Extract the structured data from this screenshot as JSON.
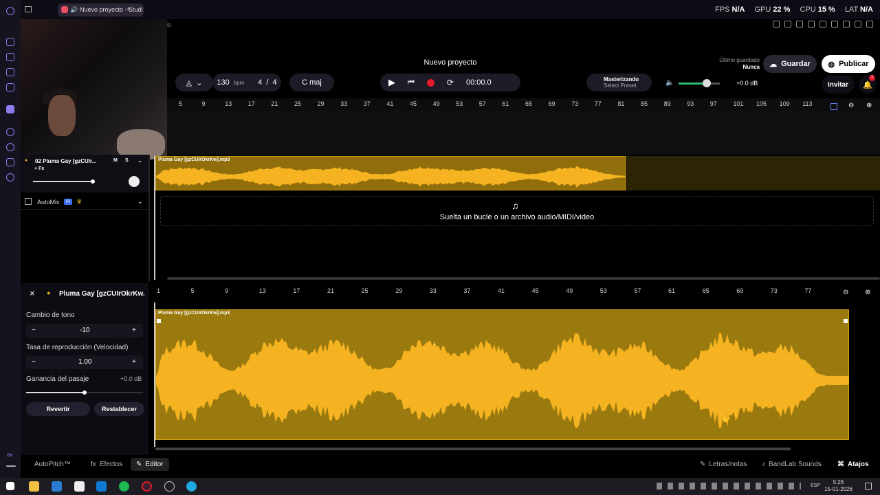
{
  "browser": {
    "tab_title": "Nuevo proyecto - Studi",
    "behind_text": "dio"
  },
  "stats": {
    "fps_label": "FPS",
    "fps_value": "N/A",
    "gpu_label": "GPU",
    "gpu_value": "22 %",
    "cpu_label": "CPU",
    "cpu_value": "15 %",
    "lat_label": "LAT",
    "lat_value": "N/A"
  },
  "header": {
    "project_title": "Nuevo proyecto",
    "last_saved_label": "Último guardado",
    "last_saved_value": "Nunca",
    "save_label": "Guardar",
    "publish_label": "Publicar",
    "invite_label": "Invitar",
    "notif_count": "1"
  },
  "transport": {
    "bpm_value": "130",
    "bpm_unit": "bpm",
    "time_sig_num": "4",
    "time_sig_den": "4",
    "key": "C maj",
    "time": "00:00.0",
    "mastering_label": "Masterizando",
    "preset_label": "Select Preset",
    "volume_db": "+0.0 dB"
  },
  "ruler_top": [
    "5",
    "9",
    "13",
    "17",
    "21",
    "25",
    "29",
    "33",
    "37",
    "41",
    "45",
    "49",
    "53",
    "57",
    "61",
    "65",
    "69",
    "73",
    "77",
    "81",
    "85",
    "89",
    "93",
    "97",
    "101",
    "105",
    "109",
    "113"
  ],
  "track": {
    "number_name": "02  Pluma Gay [gzCUIr...",
    "mute": "M",
    "solo": "S",
    "fx": "+ Fx",
    "clip_name": "Pluma Gay [gzCUIrOkrKw].mp3"
  },
  "automix": {
    "label": "AutoMix",
    "badge": "IA"
  },
  "drop_zone": {
    "text": "Suelta un bucle o un archivo audio/MIDI/video"
  },
  "editor_panel": {
    "clip_title": "Pluma Gay [gzCUIrOkrKw...",
    "pitch_label": "Cambio de tono",
    "pitch_value": "-10",
    "rate_label": "Tasa de reproducción (Velocidad)",
    "rate_value": "1.00",
    "gain_label": "Ganancia del pasaje",
    "gain_value": "+0.0 dB",
    "revert_label": "Revertir",
    "reset_label": "Restablecer",
    "minus": "−",
    "plus": "+"
  },
  "ruler_bottom": [
    "1",
    "5",
    "9",
    "13",
    "17",
    "21",
    "25",
    "29",
    "33",
    "37",
    "41",
    "45",
    "49",
    "53",
    "57",
    "61",
    "65",
    "69",
    "73",
    "77"
  ],
  "editor_clip": {
    "name": "Pluma Gay [gzCUIrOkrKw].mp3"
  },
  "bottom_bar": {
    "autopitch": "AutoPitch™",
    "effects": "Efectos",
    "editor": "Editor",
    "lyrics": "Letras/notas",
    "sounds": "BandLab Sounds",
    "shortcuts": "Atajos"
  },
  "taskbar": {
    "lang": "ESP",
    "time": "5:26",
    "date": "15-01-2026"
  },
  "colors": {
    "accent": "#f0b323",
    "waveform": "#f5b321",
    "record": "#e31b2b",
    "purple": "#8b7cf0"
  }
}
